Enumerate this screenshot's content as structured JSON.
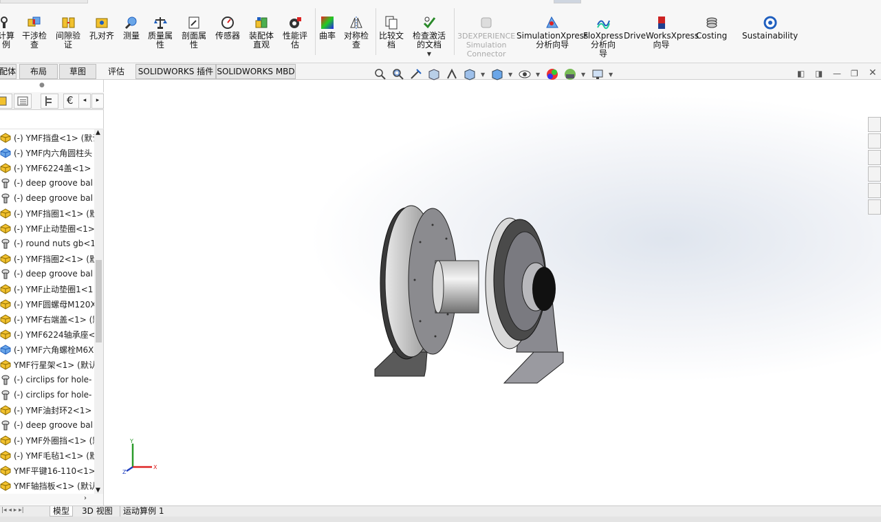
{
  "ribbon": {
    "buttons": [
      {
        "id": "calc",
        "label": "计算\n例",
        "icon": "calc-icon"
      },
      {
        "id": "interference",
        "label": "干涉检\n查",
        "icon": "interference-icon"
      },
      {
        "id": "clearance",
        "label": "间隙验\n证",
        "icon": "clearance-icon"
      },
      {
        "id": "hole",
        "label": "孔对齐",
        "icon": "hole-align-icon"
      },
      {
        "id": "measure",
        "label": "测量",
        "icon": "measure-icon"
      },
      {
        "id": "mass",
        "label": "质量属\n性",
        "icon": "mass-icon"
      },
      {
        "id": "section",
        "label": "剖面属\n性",
        "icon": "section-icon"
      },
      {
        "id": "sensor",
        "label": "传感器",
        "icon": "sensor-icon"
      },
      {
        "id": "asmvis",
        "label": "装配体\n直观",
        "icon": "assembly-visualization-icon"
      },
      {
        "id": "perf",
        "label": "性能评\n估",
        "icon": "performance-icon"
      },
      {
        "id": "curvature",
        "label": "曲率",
        "icon": "curvature-icon"
      },
      {
        "id": "symmetry",
        "label": "对称检\n查",
        "icon": "symmetry-icon"
      },
      {
        "id": "compare",
        "label": "比较文\n档",
        "icon": "compare-icon"
      },
      {
        "id": "checkactive",
        "label": "检查激活\n的文档",
        "icon": "check-active-icon"
      },
      {
        "id": "3dexp",
        "label": "3DEXPERIENCE\nSimulation\nConnector",
        "icon": "3dexperience-icon"
      },
      {
        "id": "simxpress",
        "label": "SimulationXpress\n分析向导",
        "icon": "simulationxpress-icon"
      },
      {
        "id": "floxpress",
        "label": "FloXpress\n分析向\n导",
        "icon": "floxpress-icon"
      },
      {
        "id": "driveworks",
        "label": "DriveWorksXpress\n向导",
        "icon": "driveworks-icon"
      },
      {
        "id": "costing",
        "label": "Costing",
        "icon": "costing-icon"
      },
      {
        "id": "sustain",
        "label": "Sustainability",
        "icon": "sustainability-icon"
      }
    ]
  },
  "tabs": [
    "配体",
    "布局",
    "草图",
    "评估",
    "SOLIDWORKS 插件",
    "SOLIDWORKS MBD"
  ],
  "tree": [
    {
      "label": "(-) YMF挡盘<1> (默认",
      "icon": "part"
    },
    {
      "label": "(-) YMF内六角圆柱头",
      "icon": "subasm"
    },
    {
      "label": "(-) YMF6224盖<1> (",
      "icon": "part"
    },
    {
      "label": "(-) deep groove bal",
      "icon": "toolbox"
    },
    {
      "label": "(-) deep groove bal",
      "icon": "toolbox"
    },
    {
      "label": "(-) YMF挡圈1<1> (默",
      "icon": "part"
    },
    {
      "label": "(-) YMF止动垫圈<1>",
      "icon": "part"
    },
    {
      "label": "(-) round nuts gb<1",
      "icon": "toolbox"
    },
    {
      "label": "(-) YMF挡圈2<1> (默",
      "icon": "part"
    },
    {
      "label": "(-) deep groove bal",
      "icon": "toolbox"
    },
    {
      "label": "(-) YMF止动垫圈1<1",
      "icon": "part"
    },
    {
      "label": "(-) YMF圆螺母M120X",
      "icon": "part"
    },
    {
      "label": "(-) YMF右端盖<1> (默",
      "icon": "part"
    },
    {
      "label": "(-) YMF6224轴承座<",
      "icon": "part"
    },
    {
      "label": "(-) YMF六角螺栓M6X",
      "icon": "subasm"
    },
    {
      "label": "YMF行星架<1> (默认",
      "icon": "part"
    },
    {
      "label": "(-) circlips for hole-",
      "icon": "toolbox"
    },
    {
      "label": "(-) circlips for hole-",
      "icon": "toolbox"
    },
    {
      "label": "(-) YMF油封环2<1>",
      "icon": "part"
    },
    {
      "label": "(-) deep groove bal",
      "icon": "toolbox"
    },
    {
      "label": "(-) YMF外圈挡<1> (默",
      "icon": "part"
    },
    {
      "label": "(-) YMF毛毡1<1> (默",
      "icon": "part"
    },
    {
      "label": "YMF平键16-110<1>",
      "icon": "part"
    },
    {
      "label": "YMF轴挡板<1> (默认",
      "icon": "part"
    }
  ],
  "bottom_tabs": {
    "model": "模型",
    "view3d": "3D 视图",
    "motion": "运动算例 1"
  },
  "axis": {
    "x": "X",
    "y": "Y",
    "z": "Z"
  },
  "colors": {
    "ribbon_bg": "#f7f7f7",
    "accent": "#1f5fbf",
    "part_yellow": "#f2c12e"
  }
}
